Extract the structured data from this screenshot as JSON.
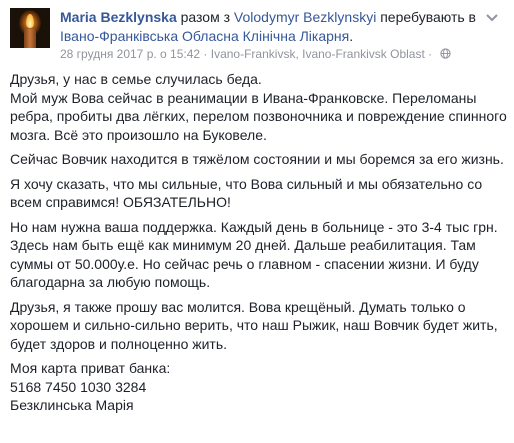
{
  "post": {
    "author": "Maria Bezklynska",
    "joiner": " разом з ",
    "mention": "Volodymyr Bezklynskyi",
    "status": " перебувають в ",
    "location_name": "Івано-Франківська Обласна Клінічна Лікарня",
    "location_end": ".",
    "timestamp": "28 грудня 2017 р. о 15:42",
    "dot": " · ",
    "place": "Ivano-Frankivsk, Ivano-Frankivsk Oblast",
    "dot2": " · ",
    "privacy_icon": "globe-icon",
    "menu_icon": "chevron-down-icon"
  },
  "body": {
    "p1": "Друзья, у нас в семье случилась беда.\nМой муж Вова сейчас в реанимации в Ивана-Франковске. Переломаны ребра, пробиты два лёгких, перелом позвоночника и повреждение спинного мозга. Всё это произошло на Буковеле.",
    "p2": "Сейчас Вовчик находится в тяжёлом состоянии и мы боремся за его жизнь.",
    "p3": "Я хочу сказать, что мы сильные, что Вова сильный и мы обязательно со всем справимся! ОБЯЗАТЕЛЬНО!",
    "p4": "Но нам нужна ваша поддержка. Каждый день в больнице - это 3-4 тыс грн. Здесь нам быть ещё как минимум 20 дней. Дальше реабилитация. Там суммы от 50.000у.е. Но сейчас речь о главном - спасении жизни. И буду благодарна за любую помощь.",
    "p5": "Друзья, я также прошу вас молится. Вова крещёный. Думать только о хорошем и сильно-сильно верить, что наш Рыжик, наш Вовчик будет жить, будет здоров и полноценно жить.",
    "bank_label": "Моя карта приват банка:",
    "card_number": "5168 7450 1030 3284",
    "card_holder": "Безклинська Марія"
  }
}
